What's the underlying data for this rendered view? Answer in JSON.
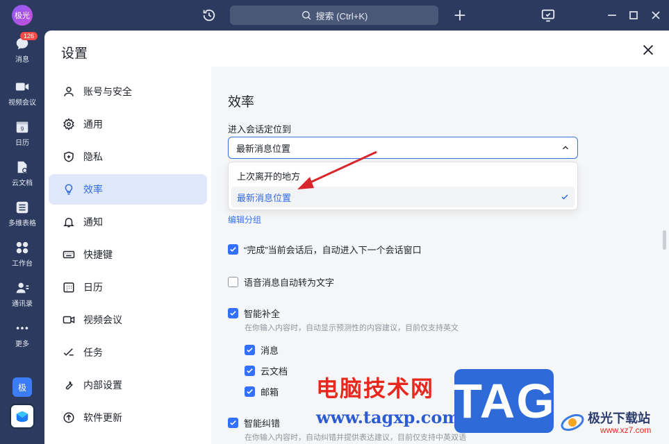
{
  "titlebar": {
    "search_label": "搜索 (Ctrl+K)"
  },
  "rail": {
    "avatar_text": "极光",
    "items": [
      {
        "label": "消息",
        "icon": "chat-icon",
        "badge": "126"
      },
      {
        "label": "视频会议",
        "icon": "video-icon"
      },
      {
        "label": "日历",
        "icon": "calendar-icon",
        "glyph": "9"
      },
      {
        "label": "云文档",
        "icon": "doc-icon"
      },
      {
        "label": "多维表格",
        "icon": "table-icon"
      },
      {
        "label": "工作台",
        "icon": "grid-icon"
      },
      {
        "label": "通讯录",
        "icon": "contacts-icon"
      },
      {
        "label": "更多",
        "icon": "more-icon"
      }
    ],
    "app1_text": "极"
  },
  "panel": {
    "title": "设置",
    "sidebar": [
      {
        "label": "账号与安全",
        "icon": "user-icon"
      },
      {
        "label": "通用",
        "icon": "gear-icon"
      },
      {
        "label": "隐私",
        "icon": "shield-icon"
      },
      {
        "label": "效率",
        "icon": "bulb-icon",
        "active": true
      },
      {
        "label": "通知",
        "icon": "bell-icon"
      },
      {
        "label": "快捷键",
        "icon": "keyboard-icon"
      },
      {
        "label": "日历",
        "icon": "calendar-icon"
      },
      {
        "label": "视频会议",
        "icon": "video-icon"
      },
      {
        "label": "任务",
        "icon": "task-icon"
      },
      {
        "label": "内部设置",
        "icon": "wrench-icon"
      },
      {
        "label": "软件更新",
        "icon": "update-icon"
      }
    ]
  },
  "content": {
    "section_title": "效率",
    "locate_label": "进入会话定位到",
    "select_value": "最新消息位置",
    "options": [
      {
        "label": "上次离开的地方",
        "selected": false
      },
      {
        "label": "最新消息位置",
        "selected": true
      }
    ],
    "edit_group_link": "编辑分组",
    "auto_next": {
      "label": "“完成”当前会话后，自动进入下一个会话窗口",
      "checked": true
    },
    "voice_to_text": {
      "label": "语音消息自动转为文字",
      "checked": false
    },
    "smart_complete": {
      "label": "智能补全",
      "checked": true,
      "hint": "在你输入内容时，自动显示预测性的内容建议，目前仅支持英文",
      "subs": [
        {
          "label": "消息",
          "checked": true
        },
        {
          "label": "云文档",
          "checked": true
        },
        {
          "label": "邮箱",
          "checked": true
        }
      ]
    },
    "smart_correct": {
      "label": "智能纠错",
      "checked": true,
      "hint": "在你输入内容时，自动纠错并提供表达建议，目前仅支持中英双语"
    }
  },
  "watermark": {
    "cn_text": "电脑技术网",
    "url_text": "www.tagxp.com",
    "tag_text": "TAG",
    "brand_name": "极光下载站",
    "brand_url": "www.xz7.com"
  },
  "colors": {
    "accent": "#3370ff",
    "rail_bg": "#2b3a5e",
    "active_bg": "#dfe8fb",
    "arrow": "#d9262c"
  }
}
